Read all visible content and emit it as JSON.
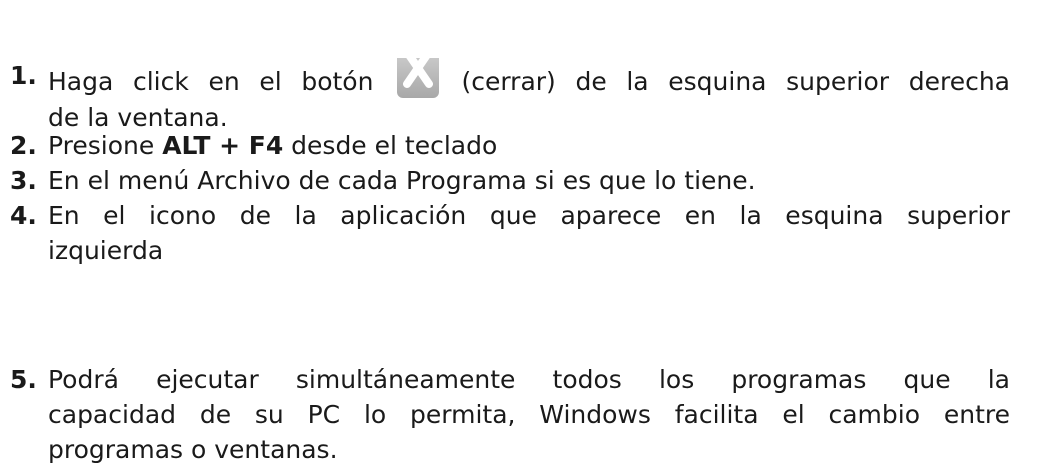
{
  "list": {
    "items": [
      {
        "number": "1.",
        "line1_before": "Haga click en el botón",
        "line1_after": "(cerrar) de la esquina superior derecha",
        "line2": "de la ventana.",
        "icon": "close-icon"
      },
      {
        "number": "2.",
        "before": "Presione ",
        "bold": "ALT + F4",
        "after": " desde el teclado"
      },
      {
        "number": "3.",
        "text": "En el menú Archivo de cada Programa si es que lo tiene."
      },
      {
        "number": "4.",
        "line1": "En el icono de la aplicación que aparece en la esquina superior",
        "line2": "izquierda"
      },
      {
        "number": "5.",
        "line1": "Podrá ejecutar simultáneamente todos los programas que la",
        "line2": "capacidad de su PC lo permita, Windows facilita el cambio entre",
        "line3": "programas o ventanas."
      }
    ]
  },
  "colors": {
    "text": "#1a1a1a",
    "icon_background": "#b9b9b9",
    "icon_glyph": "#ffffff"
  }
}
